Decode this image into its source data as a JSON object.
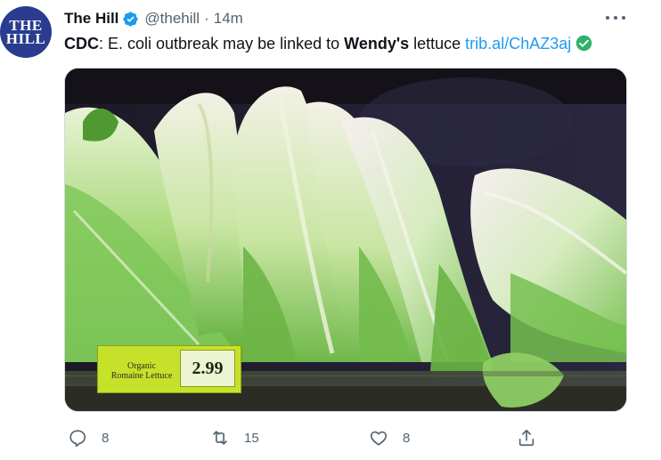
{
  "account": {
    "avatar_lines": [
      "THE",
      "HILL"
    ],
    "name": "The Hill",
    "handle": "@thehill",
    "separator": "·",
    "time": "14m"
  },
  "tweet": {
    "part1": "CDC",
    "part2": ": E. coli outbreak may be linked to ",
    "part3": "Wendy's",
    "part4": " lettuce ",
    "link": "trib.al/ChAZ3aj"
  },
  "media": {
    "shelf_label_name": "Organic Romaine Lettuce",
    "shelf_label_price": "2.99"
  },
  "actions": {
    "reply_count": "8",
    "retweet_count": "15",
    "like_count": "8"
  },
  "colors": {
    "link": "#1d9bf0",
    "secondary_text": "#536471",
    "verified_badge": "#1d9bf0",
    "link_check": "#2fb26a"
  }
}
